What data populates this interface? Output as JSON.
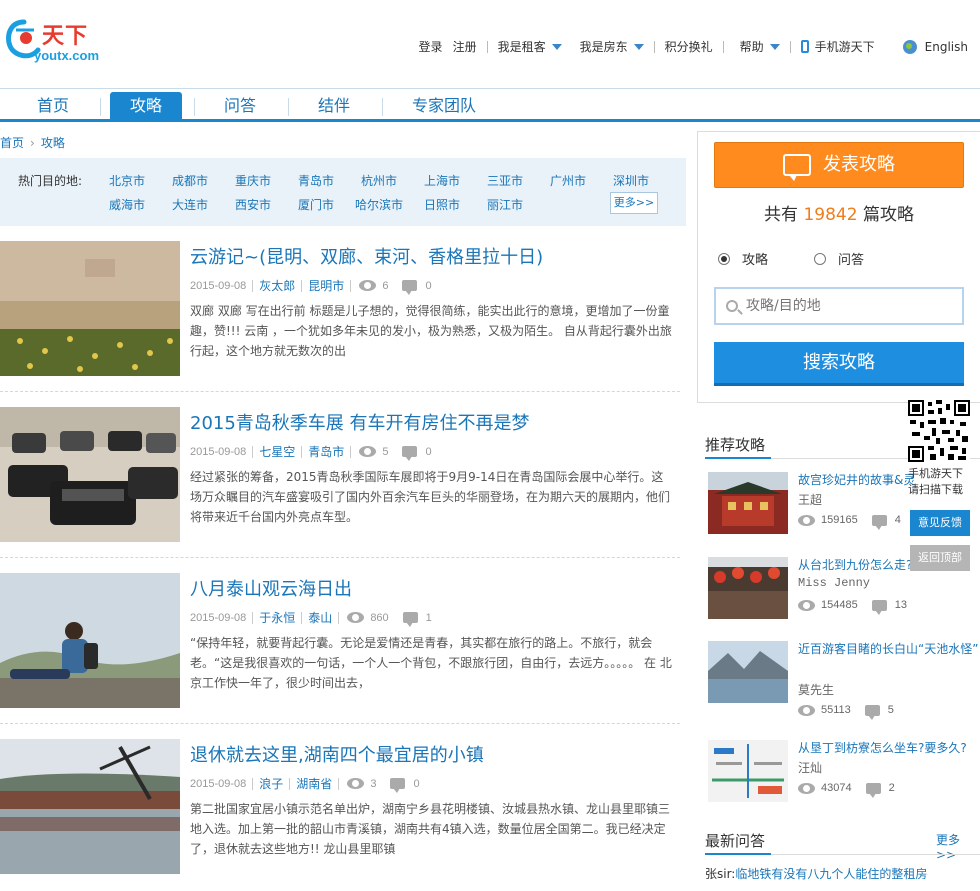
{
  "logo": {
    "cn": "天下",
    "en": "youtx.com"
  },
  "topnav": {
    "login": "登录",
    "register": "注册",
    "renter": "我是租客",
    "landlord": "我是房东",
    "points": "积分换礼",
    "help": "帮助",
    "mobile": "手机游天下",
    "english": "English"
  },
  "mainnav": {
    "tabs": [
      {
        "label": "首页"
      },
      {
        "label": "攻略"
      },
      {
        "label": "问答"
      },
      {
        "label": "结伴"
      },
      {
        "label": "专家团队"
      }
    ]
  },
  "breadcrumb": {
    "home": "首页",
    "current": "攻略"
  },
  "hot": {
    "label": "热门目的地:",
    "cities": [
      "北京市",
      "成都市",
      "重庆市",
      "青岛市",
      "杭州市",
      "上海市",
      "三亚市",
      "广州市",
      "深圳市",
      "威海市",
      "大连市",
      "西安市",
      "厦门市",
      "哈尔滨市",
      "日照市",
      "丽江市"
    ],
    "more": "更多>>"
  },
  "articles": [
    {
      "title": "云游记~(昆明、双廊、束河、香格里拉十日)",
      "date": "2015-09-08",
      "author": "灰太郎",
      "city": "昆明市",
      "views": "6",
      "comments": "0",
      "desc": "双廊 双廊 写在出行前 标题是儿子想的，觉得很简练，能实出此行的意境，更增加了一份童趣，赞!!! 云南 ，一个犹如多年未见的发小，极为熟悉，又极为陌生。 自从背起行囊外出旅行起，这个地方就无数次的出"
    },
    {
      "title": "2015青岛秋季车展 有车开有房住不再是梦",
      "date": "2015-09-08",
      "author": "七星空",
      "city": "青岛市",
      "views": "5",
      "comments": "0",
      "desc": "经过紧张的筹备，2015青岛秋季国际车展即将于9月9-14日在青岛国际会展中心举行。这场万众瞩目的汽车盛宴吸引了国内外百余汽车巨头的华丽登场，在为期六天的展期内，他们将带来近千台国内外亮点车型。"
    },
    {
      "title": "八月泰山观云海日出",
      "date": "2015-09-08",
      "author": "于永恒",
      "city": "泰山",
      "views": "860",
      "comments": "1",
      "desc": "“保持年轻，就要背起行囊。无论是爱情还是青春，其实都在旅行的路上。不旅行，就会老。“这是我很喜欢的一句话，一个人一个背包，不跟旅行团，自由行，去远方。。。。。 在 北京工作快一年了，很少时间出去，"
    },
    {
      "title": "退休就去这里,湖南四个最宜居的小镇",
      "date": "2015-09-08",
      "author": "浪子",
      "city": "湖南省",
      "views": "3",
      "comments": "0",
      "desc": "第二批国家宜居小镇示范名单出炉，湖南宁乡县花明楼镇、汝城县热水镇、龙山县里耶镇三地入选。加上第一批的韶山市青溪镇，湖南共有4镇入选，数量位居全国第二。我已经决定了，退休就去这些地方!! 龙山县里耶镇"
    }
  ],
  "sidebar": {
    "post_button": "发表攻略",
    "count_prefix": "共有",
    "count": "19842",
    "count_suffix": "篇攻略",
    "radio_guide": "攻略",
    "radio_qa": "问答",
    "search_placeholder": "攻略/目的地",
    "search_button": "搜索攻略",
    "recommend_title": "推荐攻略",
    "recommend": [
      {
        "title": "故宫珍妃井的故事&灵",
        "author": "王超",
        "views": "159165",
        "comments": "4"
      },
      {
        "title": "从台北到九份怎么走?",
        "author": "Miss Jenny",
        "views": "154485",
        "comments": "13"
      },
      {
        "title": "近百游客目睹的长白山“天池水怪”",
        "author": "莫先生",
        "views": "55113",
        "comments": "5"
      },
      {
        "title": "从垦丁到枋寮怎么坐车?要多久?",
        "author": "汪灿",
        "views": "43074",
        "comments": "2"
      }
    ],
    "qa_title": "最新问答",
    "qa_more": "更多>>",
    "qa_user": "张sir:",
    "qa_question": "临地铁有没有八九个人能住的整租房"
  },
  "float": {
    "qr_line1": "手机游天下",
    "qr_line2": "请扫描下载",
    "feedback": "意见反馈",
    "back_top": "返回顶部"
  },
  "colors": {
    "brand_blue": "#1a86cf",
    "link_blue": "#1a76b8",
    "orange": "#ff8a1e"
  }
}
